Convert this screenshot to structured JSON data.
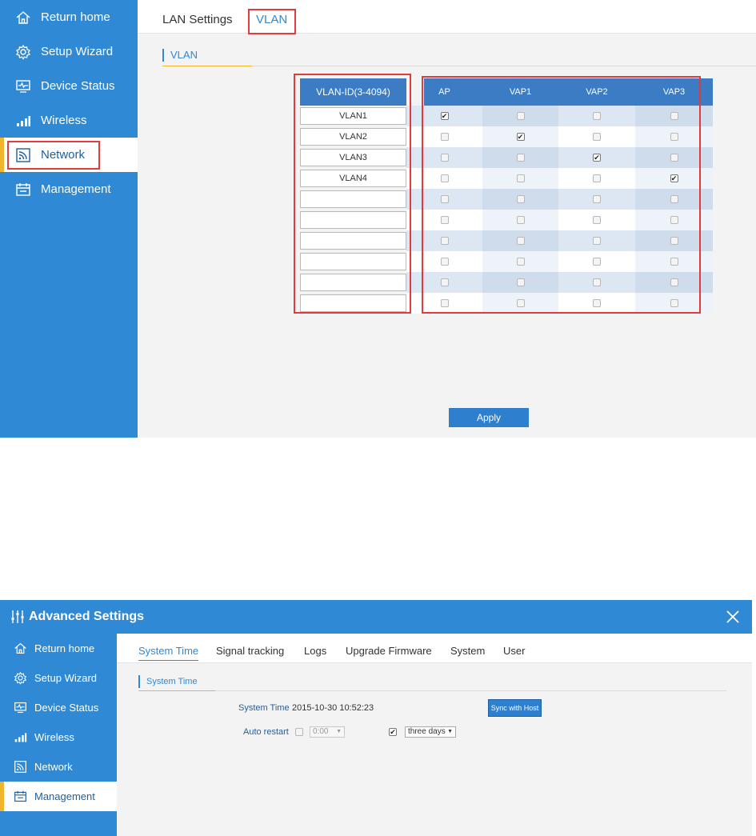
{
  "panel1": {
    "sidebar": {
      "items": [
        {
          "label": "Return home",
          "icon": "home-icon"
        },
        {
          "label": "Setup Wizard",
          "icon": "gear-icon"
        },
        {
          "label": "Device Status",
          "icon": "monitor-icon"
        },
        {
          "label": "Wireless",
          "icon": "signal-bars-icon"
        },
        {
          "label": "Network",
          "icon": "network-icon",
          "active": true
        },
        {
          "label": "Management",
          "icon": "management-icon"
        }
      ]
    },
    "tabs": [
      {
        "label": "LAN Settings"
      },
      {
        "label": "VLAN",
        "active": true
      }
    ],
    "section_title": "VLAN",
    "vlan_table": {
      "id_header": "VLAN-ID(3-4094)",
      "columns": [
        "AP",
        "VAP1",
        "VAP2",
        "VAP3"
      ],
      "rows": [
        {
          "vlan_id": "VLAN1",
          "checked": [
            true,
            false,
            false,
            false
          ]
        },
        {
          "vlan_id": "VLAN2",
          "checked": [
            false,
            true,
            false,
            false
          ]
        },
        {
          "vlan_id": "VLAN3",
          "checked": [
            false,
            false,
            true,
            false
          ]
        },
        {
          "vlan_id": "VLAN4",
          "checked": [
            false,
            false,
            false,
            true
          ]
        },
        {
          "vlan_id": "",
          "checked": [
            false,
            false,
            false,
            false
          ]
        },
        {
          "vlan_id": "",
          "checked": [
            false,
            false,
            false,
            false
          ]
        },
        {
          "vlan_id": "",
          "checked": [
            false,
            false,
            false,
            false
          ]
        },
        {
          "vlan_id": "",
          "checked": [
            false,
            false,
            false,
            false
          ]
        },
        {
          "vlan_id": "",
          "checked": [
            false,
            false,
            false,
            false
          ]
        },
        {
          "vlan_id": "",
          "checked": [
            false,
            false,
            false,
            false
          ]
        }
      ]
    },
    "apply_label": "Apply"
  },
  "panel2": {
    "window_title": "Advanced Settings",
    "sidebar": {
      "items": [
        {
          "label": "Return home",
          "icon": "home-icon"
        },
        {
          "label": "Setup Wizard",
          "icon": "gear-icon"
        },
        {
          "label": "Device Status",
          "icon": "monitor-icon"
        },
        {
          "label": "Wireless",
          "icon": "signal-bars-icon"
        },
        {
          "label": "Network",
          "icon": "network-icon"
        },
        {
          "label": "Management",
          "icon": "management-icon",
          "active": true
        }
      ]
    },
    "tabs": [
      {
        "label": "System Time",
        "active": true
      },
      {
        "label": "Signal tracking"
      },
      {
        "label": "Logs"
      },
      {
        "label": "Upgrade Firmware"
      },
      {
        "label": "System"
      },
      {
        "label": "User"
      }
    ],
    "section_title": "System Time",
    "system_time_label": "System Time",
    "system_time_value": "2015-10-30 10:52:23",
    "sync_button_label": "Sync with Host",
    "auto_restart_label": "Auto restart",
    "auto_restart_checked": false,
    "restart_time_value": "0:00",
    "restart_interval_checked": true,
    "restart_interval_value": "three days"
  },
  "colors": {
    "sidebar_blue": "#2f89d5",
    "accent_yellow": "#f0b52c",
    "highlight_red": "#e23b3b",
    "table_header_blue": "#3b7cc4"
  }
}
